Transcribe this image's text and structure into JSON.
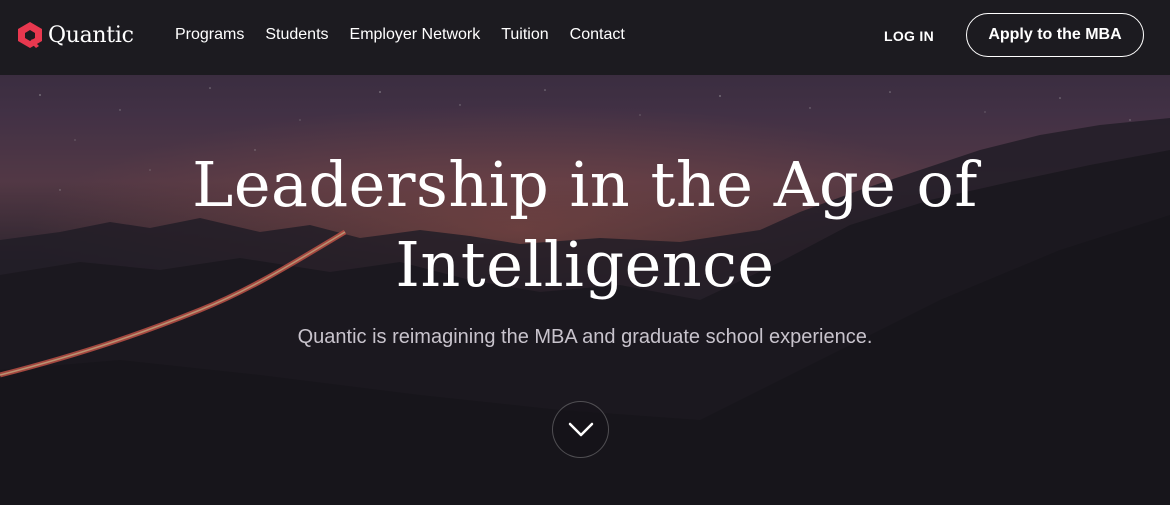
{
  "brand": {
    "name": "Quantic",
    "logo_color": "#e8384f"
  },
  "nav": {
    "links": [
      {
        "label": "Programs"
      },
      {
        "label": "Students"
      },
      {
        "label": "Employer Network"
      },
      {
        "label": "Tuition"
      },
      {
        "label": "Contact"
      }
    ],
    "login_label": "LOG IN",
    "apply_label": "Apply to the MBA"
  },
  "hero": {
    "headline_line1": "Leadership in the Age of",
    "headline_line2": "Intelligence",
    "subheadline": "Quantic is reimagining the MBA and graduate school experience.",
    "scroll_icon": "chevron-down-icon"
  }
}
